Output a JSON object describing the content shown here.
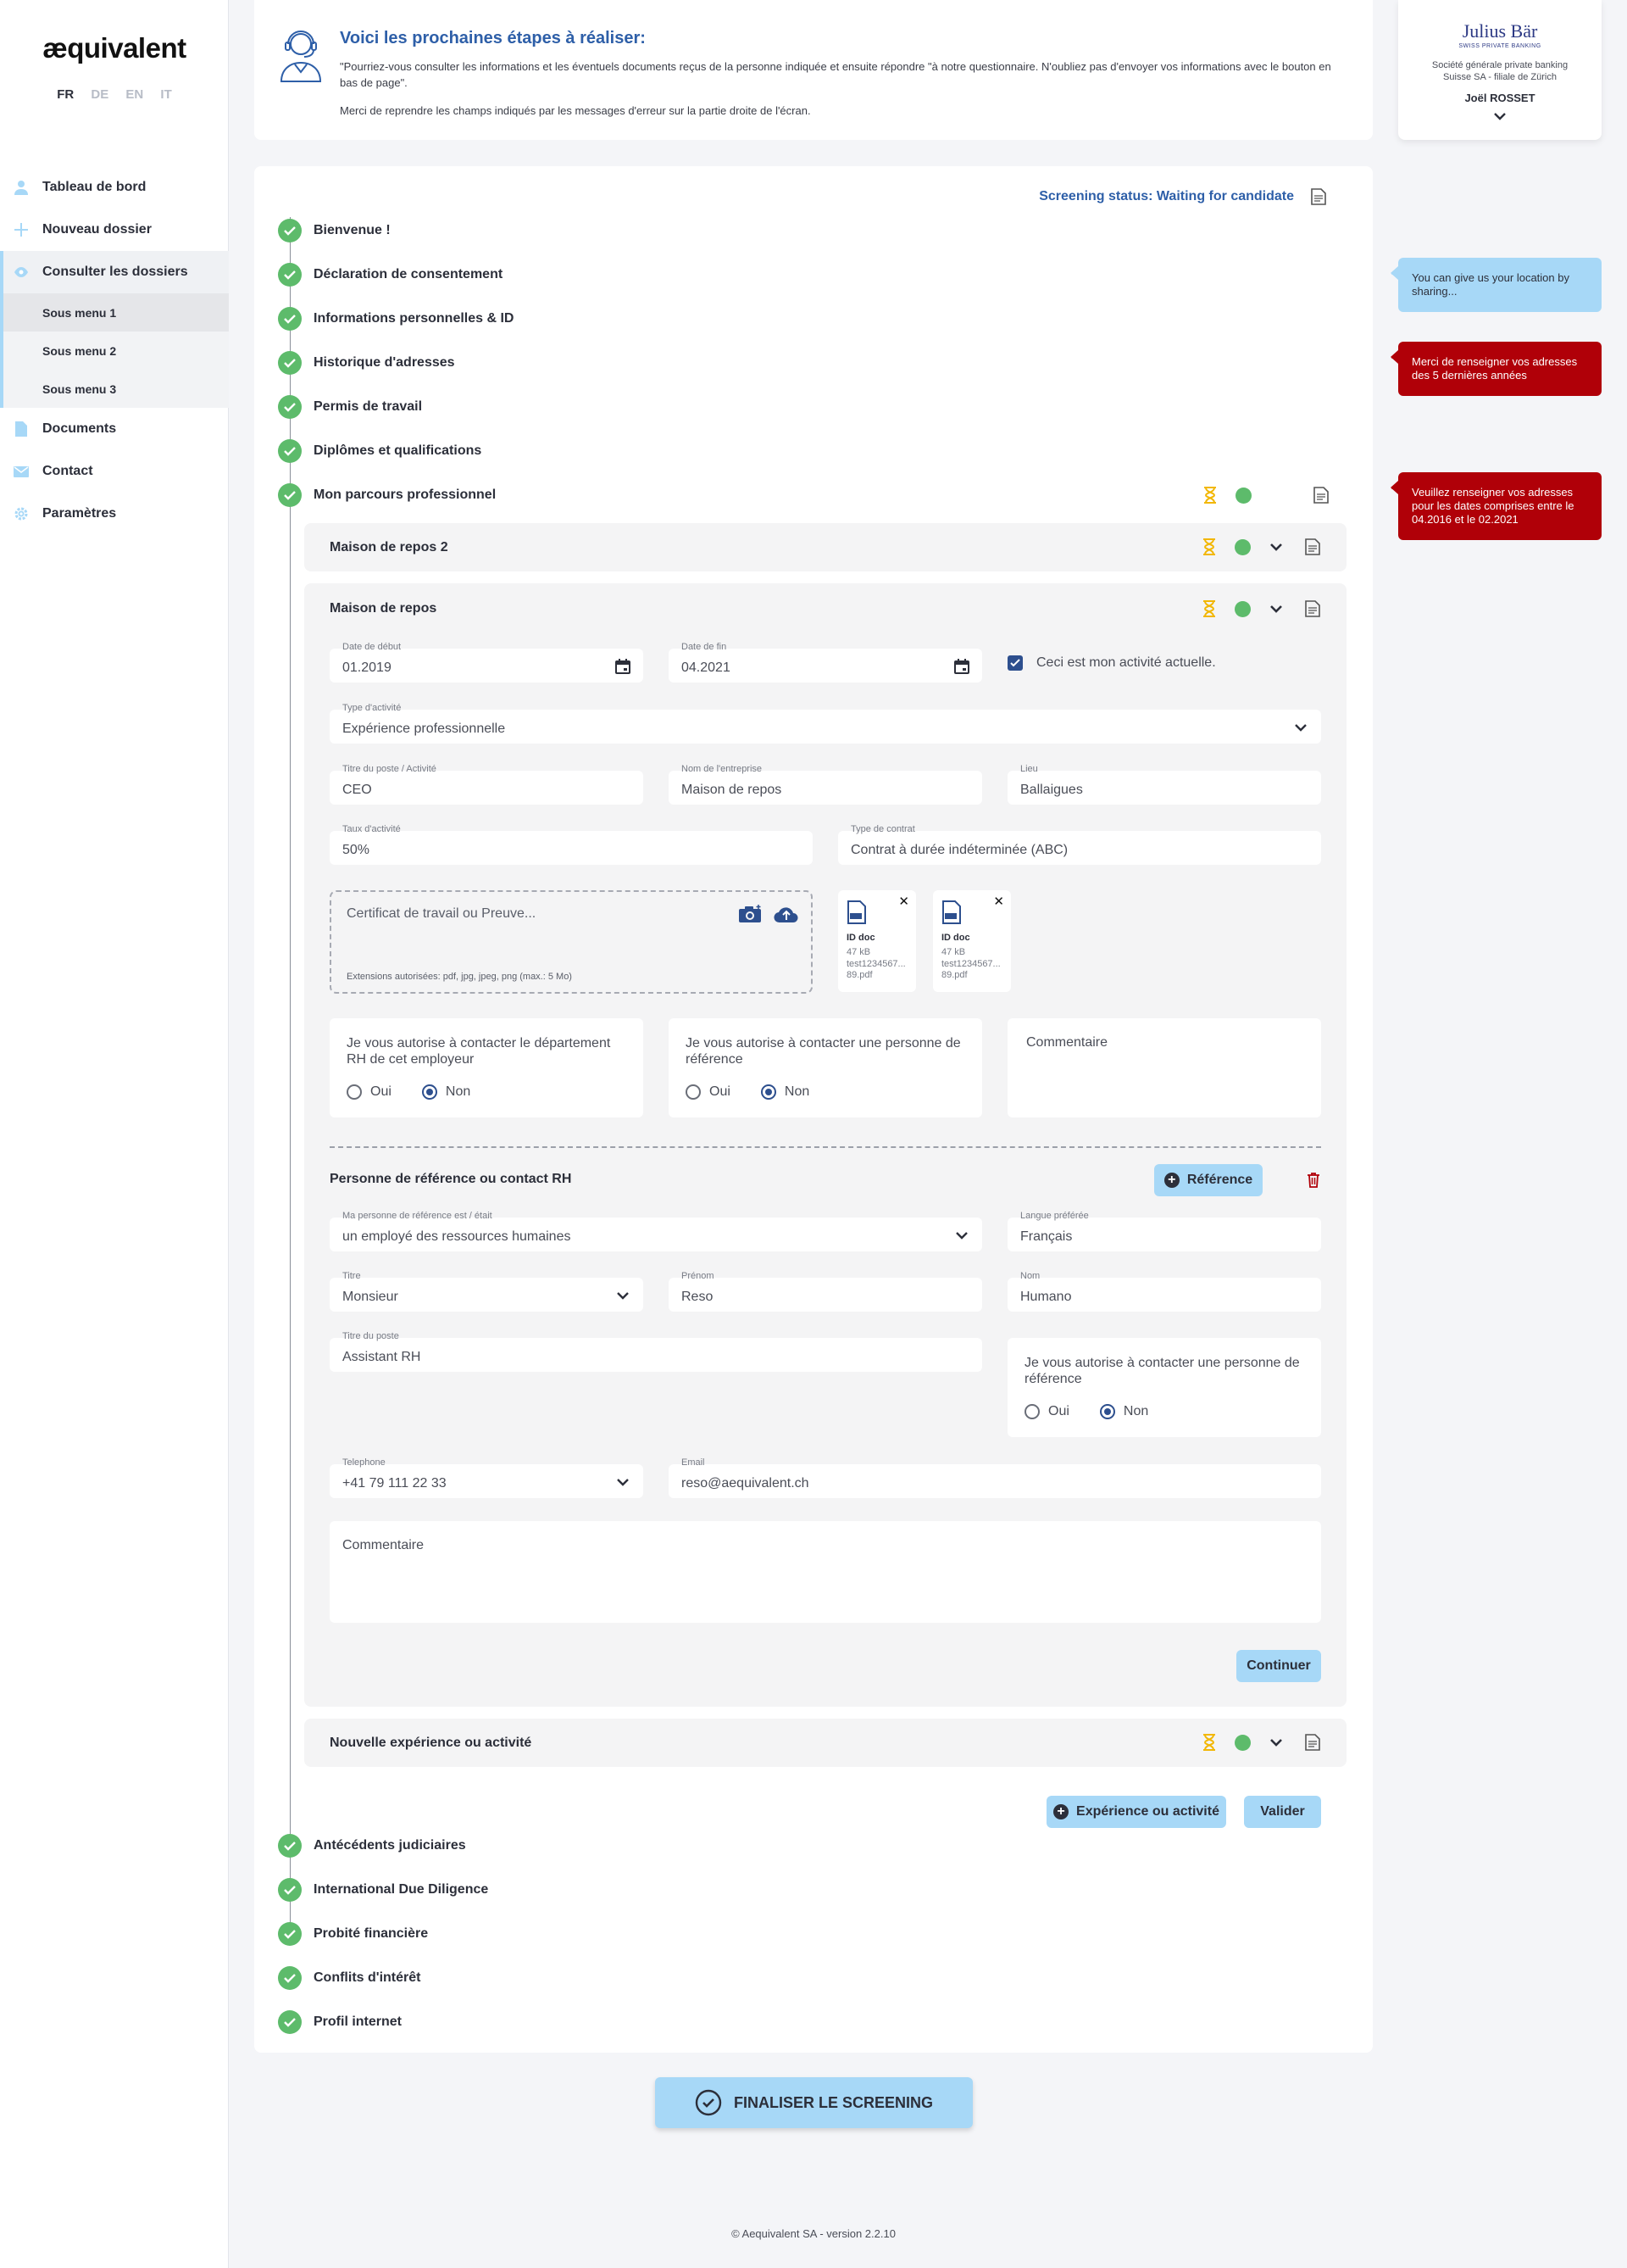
{
  "brand": {
    "logo": "æquivalent",
    "languages": [
      "FR",
      "DE",
      "EN",
      "IT"
    ],
    "active_language": "FR"
  },
  "sidebar": {
    "items": [
      {
        "label": "Tableau de bord",
        "icon": "user-icon"
      },
      {
        "label": "Nouveau dossier",
        "icon": "plus-icon"
      },
      {
        "label": "Consulter les dossiers",
        "icon": "eye-icon"
      },
      {
        "label": "Documents",
        "icon": "document-icon"
      },
      {
        "label": "Contact",
        "icon": "mail-icon"
      },
      {
        "label": "Paramètres",
        "icon": "gear-icon"
      }
    ],
    "submenu": [
      "Sous menu 1",
      "Sous menu 2",
      "Sous menu 3"
    ]
  },
  "info": {
    "title": "Voici les prochaines étapes à réaliser:",
    "paragraph1": "\"Pourriez-vous consulter les informations et les éventuels documents reçus de la personne indiquée et ensuite répondre \"à notre questionnaire. N'oubliez pas d'envoyer vos informations avec le bouton en bas de page\".",
    "paragraph2": "Merci de reprendre les champs indiqués par les messages d'erreur sur la partie droite de l'écran."
  },
  "bank": {
    "name": "Julius Bär",
    "tagline": "SWISS PRIVATE BANKING",
    "desc_line1": "Société générale private banking",
    "desc_line2": "Suisse SA - filiale de Zürich",
    "user": "Joël ROSSET"
  },
  "screening_status": "Screening status: Waiting for candidate",
  "steps": [
    "Bienvenue !",
    "Déclaration de consentement",
    "Informations personnelles & ID",
    "Historique d'adresses",
    "Permis de travail",
    "Diplômes et qualifications",
    "Mon parcours professionnel"
  ],
  "steps_after": [
    "Antécédents judiciaires",
    "International Due Diligence",
    "Probité financière",
    "Conflits d'intérêt",
    "Profil internet"
  ],
  "experiences": {
    "collapsed_title": "Maison de repos 2",
    "open_title": "Maison de repos",
    "new_title": "Nouvelle expérience ou activité"
  },
  "form": {
    "start_date": {
      "label": "Date de début",
      "value": "01.2019"
    },
    "end_date": {
      "label": "Date de fin",
      "value": "04.2021"
    },
    "current_activity": "Ceci est mon activité actuelle.",
    "activity_type": {
      "label": "Type d'activité",
      "value": "Expérience professionnelle"
    },
    "job_title": {
      "label": "Titre du poste / Activité",
      "value": "CEO"
    },
    "company": {
      "label": "Nom de l'entreprise",
      "value": "Maison de repos"
    },
    "place": {
      "label": "Lieu",
      "value": "Ballaigues"
    },
    "rate": {
      "label": "Taux d'activité",
      "value": "50%"
    },
    "contract": {
      "label": "Type de contrat",
      "value": "Contrat à durée indéterminée (ABC)"
    },
    "upload_placeholder": "Certificat de travail ou Preuve...",
    "upload_ext": "Extensions autorisées: pdf, jpg, jpeg, png (max.: 5 Mo)",
    "files": [
      {
        "name": "ID doc",
        "size": "47 kB",
        "file_line1": "test1234567...",
        "file_line2": "89.pdf"
      },
      {
        "name": "ID doc",
        "size": "47 kB",
        "file_line1": "test1234567...",
        "file_line2": "89.pdf"
      }
    ],
    "auth_hr": "Je vous autorise à contacter le département RH de cet employeur",
    "auth_ref": "Je vous autorise à contacter une personne de référence",
    "yes": "Oui",
    "no": "Non",
    "comment": "Commentaire"
  },
  "reference": {
    "title": "Personne de référence ou contact RH",
    "add_button": "Référence",
    "person_type": {
      "label": "Ma personne de référence est / était",
      "value": "un employé des ressources humaines"
    },
    "language": {
      "label": "Langue préférée",
      "value": "Français"
    },
    "civility": {
      "label": "Titre",
      "value": "Monsieur"
    },
    "firstname": {
      "label": "Prénom",
      "value": "Reso"
    },
    "lastname": {
      "label": "Nom",
      "value": "Humano"
    },
    "job": {
      "label": "Titre du poste",
      "value": "Assistant RH"
    },
    "auth": "Je vous autorise à contacter une personne de référence",
    "phone": {
      "label": "Telephone",
      "value": "+41 79 111 22 33"
    },
    "email": {
      "label": "Email",
      "value": "reso@aequivalent.ch"
    },
    "comment": "Commentaire",
    "continue": "Continuer"
  },
  "actions": {
    "add_experience": "Expérience ou activité",
    "validate": "Valider",
    "finalize": "FINALISER LE SCREENING"
  },
  "tips": [
    {
      "text": "You can give us your location by sharing...",
      "color": "#a7d8f7"
    },
    {
      "text": "Merci de renseigner vos adresses des 5 dernières années",
      "color": "#b00008"
    },
    {
      "text": "Veuillez renseigner vos adresses pour les dates comprises entre le 04.2016 et le 02.2021",
      "color": "#b00008"
    }
  ],
  "footer": "© Aequivalent SA - version 2.2.10",
  "colors": {
    "accent": "#a7d8f7",
    "primary": "#2e5fa8",
    "success": "#5dbb6b",
    "warning": "#f2b705",
    "error": "#b00008"
  }
}
